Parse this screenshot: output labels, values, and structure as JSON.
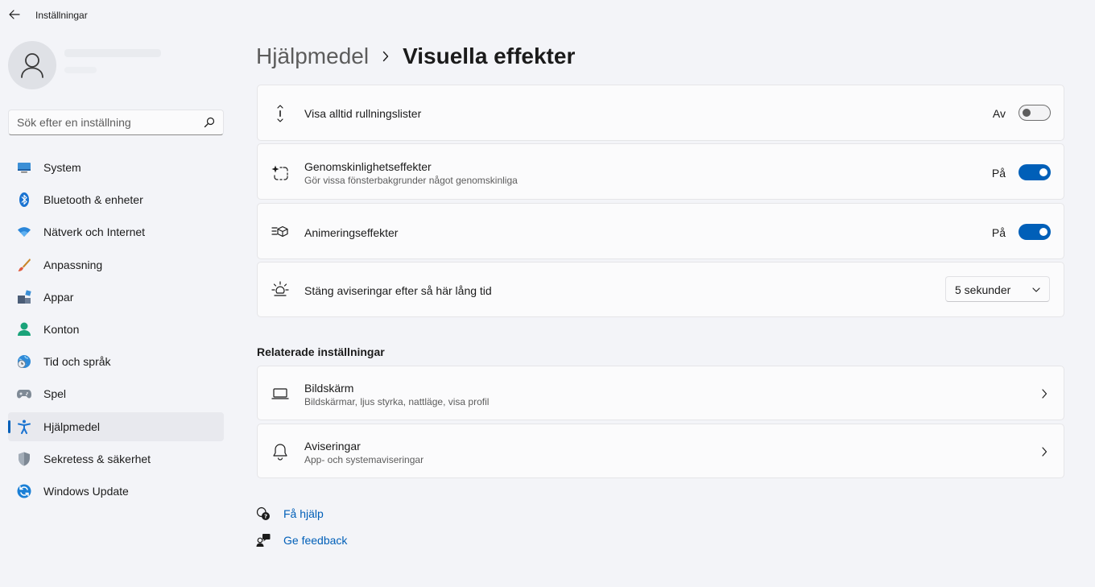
{
  "window": {
    "title": "Inställningar"
  },
  "search": {
    "placeholder": "Sök efter en inställning"
  },
  "sidebar": {
    "items": [
      {
        "label": "System",
        "icon": "system-icon"
      },
      {
        "label": "Bluetooth & enheter",
        "icon": "bluetooth-icon"
      },
      {
        "label": "Nätverk och Internet",
        "icon": "wifi-icon"
      },
      {
        "label": "Anpassning",
        "icon": "brush-icon"
      },
      {
        "label": "Appar",
        "icon": "apps-icon"
      },
      {
        "label": "Konton",
        "icon": "account-icon"
      },
      {
        "label": "Tid och språk",
        "icon": "globe-clock-icon"
      },
      {
        "label": "Spel",
        "icon": "gamepad-icon"
      },
      {
        "label": "Hjälpmedel",
        "icon": "accessibility-icon",
        "active": true
      },
      {
        "label": "Sekretess & säkerhet",
        "icon": "shield-icon"
      },
      {
        "label": "Windows Update",
        "icon": "update-icon"
      }
    ]
  },
  "breadcrumb": {
    "parent": "Hjälpmedel",
    "current": "Visuella effekter"
  },
  "settings": {
    "scrollbars": {
      "title": "Visa alltid rullningslister",
      "state_label": "Av",
      "on": false,
      "icon": "scrollbar-icon"
    },
    "transparency": {
      "title": "Genomskinlighetseffekter",
      "subtitle": "Gör vissa fönsterbakgrunder något genomskinliga",
      "state_label": "På",
      "on": true,
      "icon": "transparency-icon"
    },
    "animation": {
      "title": "Animeringseffekter",
      "state_label": "På",
      "on": true,
      "icon": "animation-icon"
    },
    "notifications": {
      "title": "Stäng aviseringar efter så här lång tid",
      "value": "5 sekunder",
      "icon": "sun-icon"
    }
  },
  "related": {
    "title": "Relaterade inställningar",
    "items": [
      {
        "title": "Bildskärm",
        "subtitle": "Bildskärmar, ljus styrka, nattläge, visa profil",
        "icon": "laptop-icon"
      },
      {
        "title": "Aviseringar",
        "subtitle": "App- och systemaviseringar",
        "icon": "bell-icon"
      }
    ]
  },
  "help": {
    "get_help": "Få hjälp",
    "feedback": "Ge feedback"
  },
  "colors": {
    "accent": "#005fb8",
    "background": "#f3f4f8",
    "card": "#fbfbfc"
  }
}
